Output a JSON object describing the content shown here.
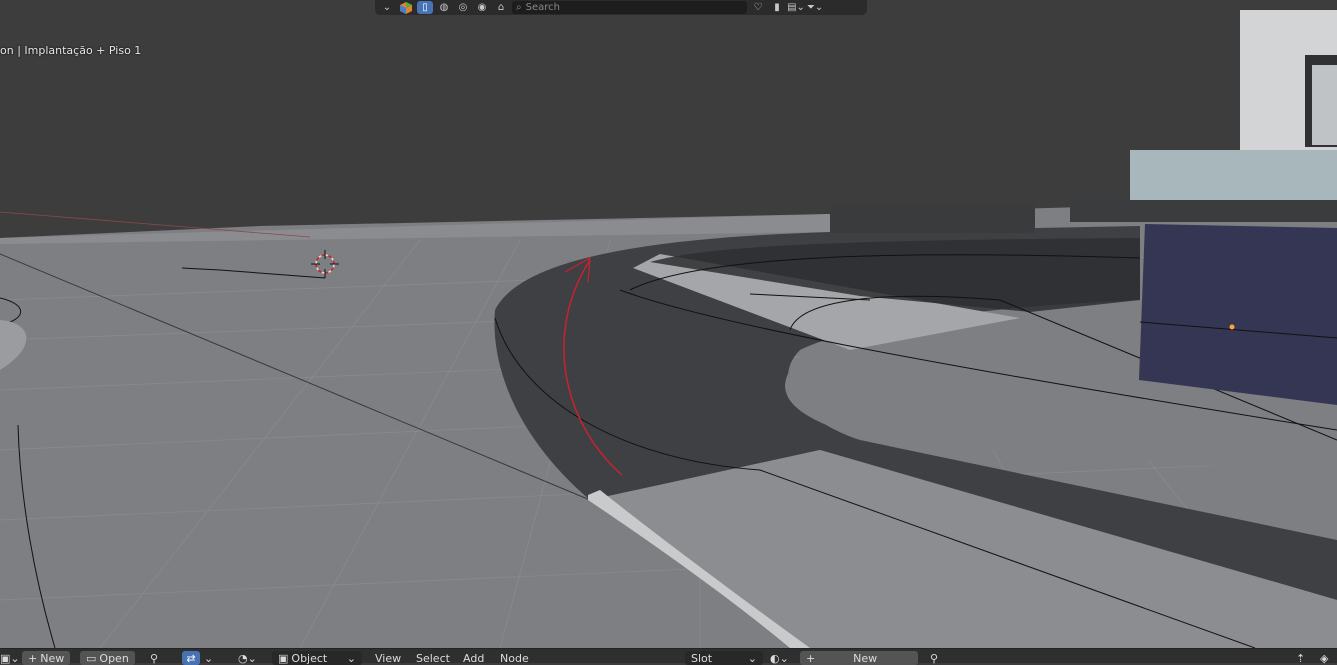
{
  "viewport": {
    "overlay_text": "on | Implantação + Piso 1"
  },
  "header": {
    "search_placeholder": "Search",
    "icons": [
      "chevron-down-icon",
      "color-management-icon",
      "solid-mode-icon",
      "material-icon",
      "rendered-icon",
      "world-icon",
      "node-icon",
      "search-icon",
      "bookmark-icon",
      "layout-icon",
      "filter-icon"
    ]
  },
  "bottom_bar": {
    "new_label": "New",
    "open_label": "Open",
    "mode_value": "Object",
    "menus": [
      "View",
      "Select",
      "Add",
      "Node"
    ],
    "slot_value": "Slot",
    "material_new_label": "New"
  },
  "colors": {
    "accent": "#4772b3",
    "viewport_bg": "#3d3d3d",
    "header_bg": "#2b2b2b",
    "selection_curve": "#c8232c",
    "origin_point": "#ffa233"
  }
}
